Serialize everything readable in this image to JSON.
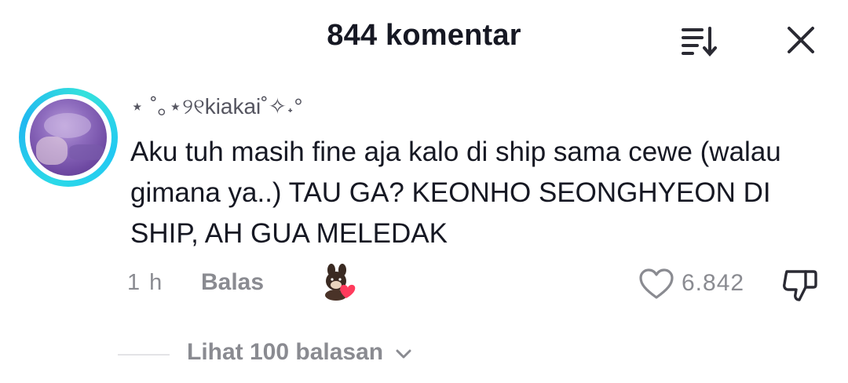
{
  "header": {
    "title": "844 komentar",
    "sort_icon": "sort-descending-icon",
    "close_icon": "close-icon"
  },
  "comment": {
    "username": "⋆ ˚｡⋆୨୧kiakai˚✧˖°",
    "text": "Aku tuh masih fine aja kalo di ship sama cewe (walau gimana ya..) TAU GA? KEONHO SEONGHYEON DI SHIP, AH GUA MELEDAK",
    "time": "1 h",
    "reply_label": "Balas",
    "likes": "6.842",
    "avatar_ring_color": "#2bd9e8",
    "sticker": "bear-heart-sticker",
    "like_icon": "heart-outline-icon",
    "dislike_icon": "thumbs-down-icon"
  },
  "replies": {
    "view_label": "Lihat 100 balasan",
    "chevron_icon": "chevron-down-icon"
  },
  "colors": {
    "text_primary": "#161823",
    "text_secondary": "#8a8b91",
    "background": "#ffffff"
  }
}
